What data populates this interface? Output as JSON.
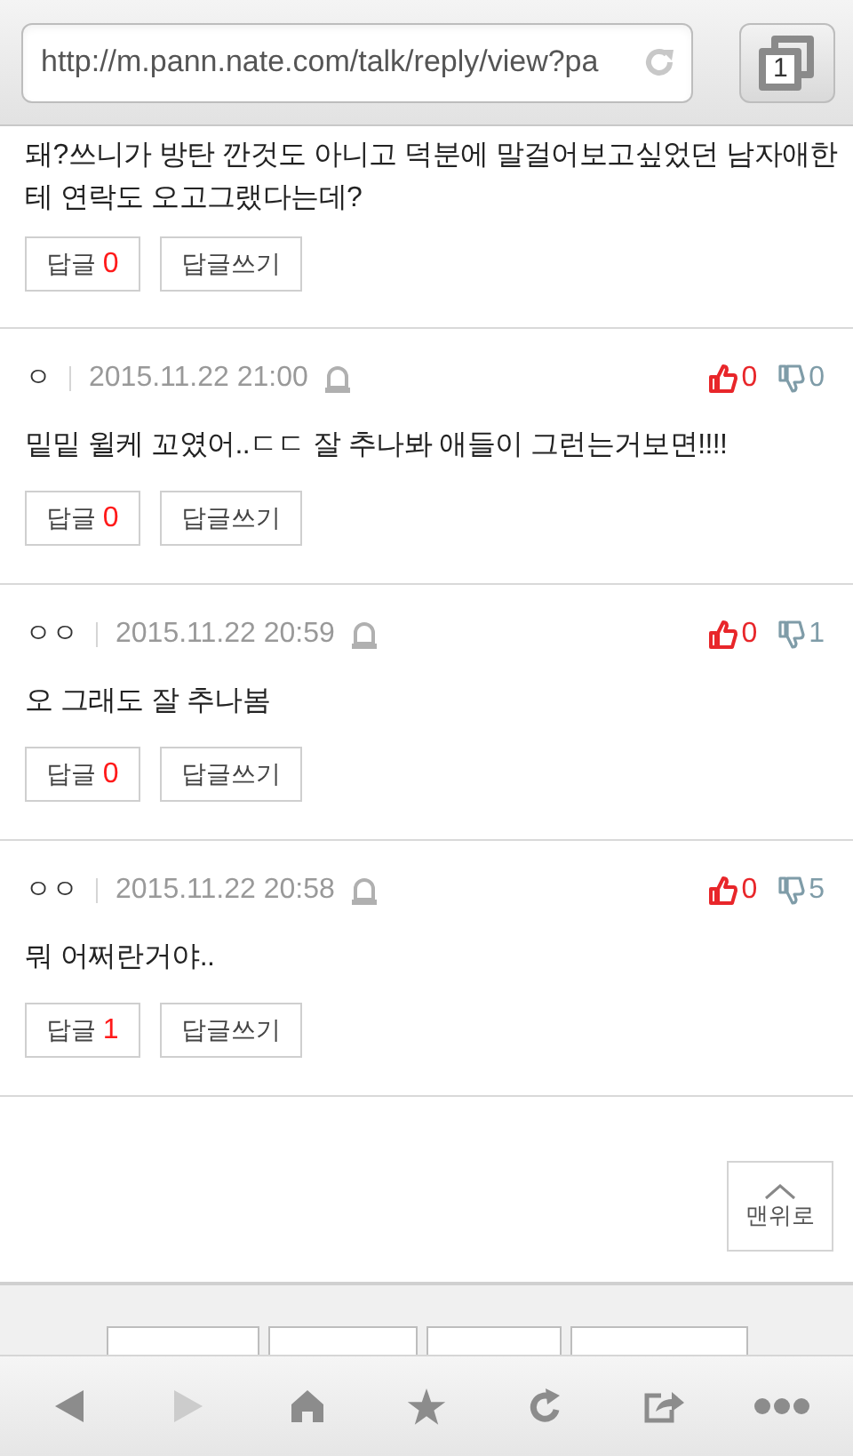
{
  "address_bar": {
    "url": "http://m.pann.nate.com/talk/reply/view?pa",
    "tab_count": "1"
  },
  "comments": [
    {
      "kind": "partial",
      "text": "돼?쓰니가 방탄 깐것도 아니고 덕분에 말걸어보고싶었던 남자애한테 연락도 오고그랬다는데?",
      "reply_label": "답글",
      "reply_count": "0",
      "write_reply": "답글쓰기"
    },
    {
      "kind": "full",
      "author": "ㅇ",
      "date": "2015.11.22 21:00",
      "likes": "0",
      "dislikes": "0",
      "text": "밑밑 윌케 꼬였어..ㄷㄷ 잘 추나봐 애들이 그런는거보면!!!!",
      "reply_label": "답글",
      "reply_count": "0",
      "write_reply": "답글쓰기"
    },
    {
      "kind": "full",
      "author": "ㅇㅇ",
      "date": "2015.11.22 20:59",
      "likes": "0",
      "dislikes": "1",
      "text": "오 그래도 잘 추나봄",
      "reply_label": "답글",
      "reply_count": "0",
      "write_reply": "답글쓰기"
    },
    {
      "kind": "full",
      "author": "ㅇㅇ",
      "date": "2015.11.22 20:58",
      "likes": "0",
      "dislikes": "5",
      "text": "뭐 어쩌란거야..",
      "reply_label": "답글",
      "reply_count": "1",
      "write_reply": "답글쓰기"
    }
  ],
  "top_button": {
    "label": "맨위로"
  },
  "toolbar": [
    {
      "kind": "back",
      "disabled": false
    },
    {
      "kind": "forward",
      "disabled": true
    },
    {
      "kind": "home",
      "disabled": false
    },
    {
      "kind": "star",
      "disabled": false
    },
    {
      "kind": "refresh",
      "disabled": false
    },
    {
      "kind": "share",
      "disabled": false
    },
    {
      "kind": "more",
      "disabled": false
    }
  ]
}
